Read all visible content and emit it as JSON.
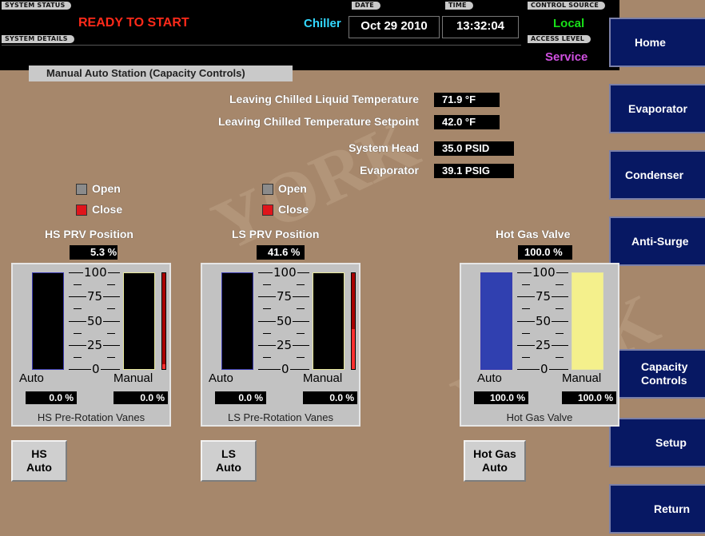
{
  "header": {
    "system_status_label": "SYSTEM STATUS",
    "system_status_value": "READY TO START",
    "equipment": "Chiller",
    "system_details_label": "SYSTEM DETAILS",
    "date_label": "DATE",
    "date_value": "Oct 29 2010",
    "time_label": "TIME",
    "time_value": "13:32:04",
    "control_source_label": "CONTROL SOURCE",
    "control_source_value": "Local",
    "access_level_label": "ACCESS LEVEL",
    "access_level_value": "Service"
  },
  "nav": {
    "home": "Home",
    "evaporator": "Evaporator",
    "condenser": "Condenser",
    "anti_surge": "Anti-Surge",
    "capacity_line1": "Capacity",
    "capacity_line2": "Controls",
    "setup": "Setup",
    "return": "Return"
  },
  "page": {
    "title": "Manual Auto Station (Capacity Controls)"
  },
  "readings": [
    {
      "label": "Leaving Chilled Liquid Temperature",
      "value": "71.9 °F"
    },
    {
      "label": "Leaving Chilled Temperature Setpoint",
      "value": "42.0 °F"
    },
    {
      "label": "System Head",
      "value": "35.0 PSID"
    },
    {
      "label": "Evaporator",
      "value": "39.1 PSIG"
    }
  ],
  "indicators": {
    "hs_open": "Open",
    "hs_close": "Close",
    "ls_open": "Open",
    "ls_close": "Close"
  },
  "stations": {
    "hs": {
      "title": "HS PRV Position",
      "position": "5.3 %",
      "auto_label": "Auto",
      "manual_label": "Manual",
      "auto_value": "0.0 %",
      "manual_value": "0.0 %",
      "footer": "HS Pre-Rotation Vanes",
      "btn_line1": "HS",
      "btn_line2": "Auto",
      "auto_level": 0.0,
      "manual_level": 0.0,
      "position_level": 0.053
    },
    "ls": {
      "title": "LS PRV Position",
      "position": "41.6 %",
      "auto_label": "Auto",
      "manual_label": "Manual",
      "auto_value": "0.0 %",
      "manual_value": "0.0 %",
      "footer": "LS Pre-Rotation Vanes",
      "btn_line1": "LS",
      "btn_line2": "Auto",
      "auto_level": 0.0,
      "manual_level": 0.0,
      "position_level": 0.416
    },
    "hgv": {
      "title": "Hot Gas Valve",
      "position": "100.0 %",
      "auto_label": "Auto",
      "manual_label": "Manual",
      "auto_value": "100.0 %",
      "manual_value": "100.0 %",
      "footer": "Hot Gas Valve",
      "btn_line1": "Hot Gas",
      "btn_line2": "Auto",
      "auto_level": 1.0,
      "manual_level": 1.0
    }
  },
  "scale": {
    "t100": "100",
    "t75": "75",
    "t50": "50",
    "t25": "25",
    "t0": "0"
  },
  "colors": {
    "background": "#a6876b",
    "nav": "#071863",
    "status_red": "#ff2a1a",
    "chiller_cyan": "#33d8ff",
    "local_green": "#18e018",
    "service_magenta": "#d050e0",
    "hgv_auto_fill": "#3040b0",
    "hgv_manual_fill": "#f4f08c"
  }
}
